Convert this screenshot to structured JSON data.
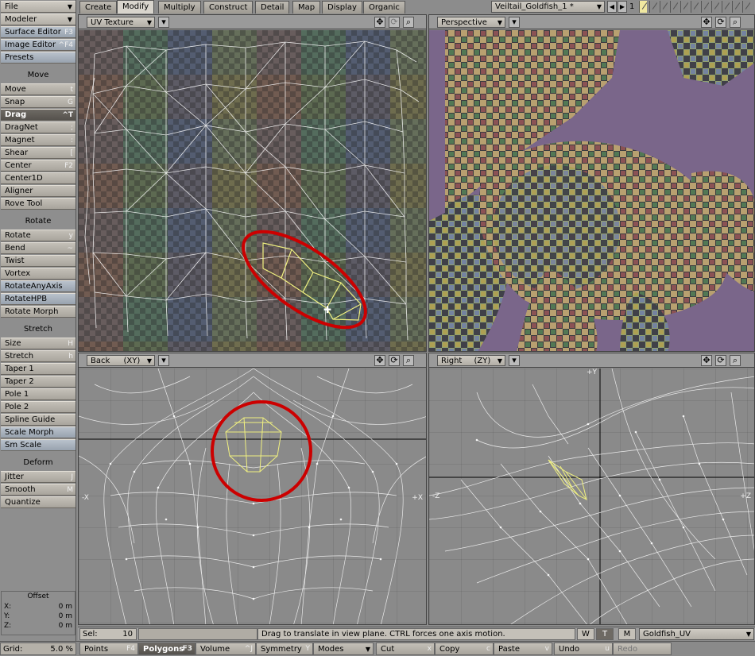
{
  "menu": {
    "file": "File",
    "modeler": "Modeler",
    "surface_editor": {
      "label": "Surface Editor",
      "shortcut": "F3"
    },
    "image_editor": {
      "label": "Image Editor",
      "shortcut": "^F4"
    },
    "presets": "Presets"
  },
  "toolbar": {
    "move_header": "Move",
    "move": {
      "label": "Move",
      "shortcut": "t"
    },
    "snap": {
      "label": "Snap",
      "shortcut": "G"
    },
    "drag": {
      "label": "Drag",
      "shortcut": "^T"
    },
    "dragnet": {
      "label": "DragNet",
      "shortcut": ";"
    },
    "magnet": {
      "label": "Magnet",
      "shortcut": ":"
    },
    "shear": {
      "label": "Shear",
      "shortcut": "["
    },
    "center": {
      "label": "Center",
      "shortcut": "F2"
    },
    "center1d": {
      "label": "Center1D",
      "shortcut": ""
    },
    "aligner": {
      "label": "Aligner",
      "shortcut": ""
    },
    "rove": {
      "label": "Rove Tool",
      "shortcut": ""
    },
    "rotate_header": "Rotate",
    "rotate": {
      "label": "Rotate",
      "shortcut": "y"
    },
    "bend": {
      "label": "Bend",
      "shortcut": "~"
    },
    "twist": {
      "label": "Twist",
      "shortcut": ""
    },
    "vortex": {
      "label": "Vortex",
      "shortcut": ""
    },
    "rotateanyaxis": {
      "label": "RotateAnyAxis",
      "shortcut": ""
    },
    "rotatehpb": {
      "label": "RotateHPB",
      "shortcut": ""
    },
    "rotatemorph": {
      "label": "Rotate Morph",
      "shortcut": ""
    },
    "stretch_header": "Stretch",
    "size": {
      "label": "Size",
      "shortcut": "H"
    },
    "stretch": {
      "label": "Stretch",
      "shortcut": "h"
    },
    "taper1": {
      "label": "Taper 1",
      "shortcut": ""
    },
    "taper2": {
      "label": "Taper 2",
      "shortcut": ""
    },
    "pole1": {
      "label": "Pole 1",
      "shortcut": ""
    },
    "pole2": {
      "label": "Pole 2",
      "shortcut": ""
    },
    "splineguide": {
      "label": "Spline Guide",
      "shortcut": ""
    },
    "scalemorph": {
      "label": "Scale Morph",
      "shortcut": ""
    },
    "smscale": {
      "label": "Sm Scale",
      "shortcut": ""
    },
    "deform_header": "Deform",
    "jitter": {
      "label": "Jitter",
      "shortcut": "J"
    },
    "smooth": {
      "label": "Smooth",
      "shortcut": "M"
    },
    "quantize": {
      "label": "Quantize",
      "shortcut": ""
    }
  },
  "offset": {
    "title": "Offset",
    "x_label": "X:",
    "x": "0 m",
    "y_label": "Y:",
    "y": "0 m",
    "z_label": "Z:",
    "z": "0 m"
  },
  "tabs": [
    "Create",
    "Modify",
    "Multiply",
    "Construct",
    "Detail",
    "Map",
    "Display",
    "Organic"
  ],
  "active_tab": "Modify",
  "object": "Veiltail_Goldfish_1 *",
  "layer_number": "1",
  "viewports": {
    "top_left": {
      "view": "UV Texture"
    },
    "top_right": {
      "view": "Perspective"
    },
    "bottom_left": {
      "view": "Back",
      "axis": "(XY)",
      "left_axis": "-X",
      "right_axis": "+X"
    },
    "bottom_right": {
      "view": "Right",
      "axis": "(ZY)",
      "left_axis": "-Z",
      "right_axis": "+Z",
      "top_axis": "+Y"
    }
  },
  "status": {
    "sel_label": "Sel:",
    "sel_value": "10",
    "hint": "Drag to translate in view plane. CTRL forces one axis motion.",
    "w": "W",
    "t": "T",
    "m": "M",
    "map": "Goldfish_UV"
  },
  "bottom": {
    "grid_label": "Grid:",
    "grid_value": "5.0 %",
    "points": {
      "label": "Points",
      "shortcut": "F4"
    },
    "polygons": {
      "label": "Polygons",
      "shortcut": "F3"
    },
    "volume": {
      "label": "Volume",
      "shortcut": "^J"
    },
    "symmetry": {
      "label": "Symmetry",
      "shortcut": "Y"
    },
    "modes": "Modes",
    "cut": {
      "label": "Cut",
      "shortcut": "x"
    },
    "copy": {
      "label": "Copy",
      "shortcut": "c"
    },
    "paste": {
      "label": "Paste",
      "shortcut": "v"
    },
    "undo": {
      "label": "Undo",
      "shortcut": "u"
    },
    "redo": "Redo"
  },
  "colors": {
    "highlight_ring": "#cc0000",
    "selection": "#f0f080",
    "perspective_bg": "#7a668a"
  }
}
